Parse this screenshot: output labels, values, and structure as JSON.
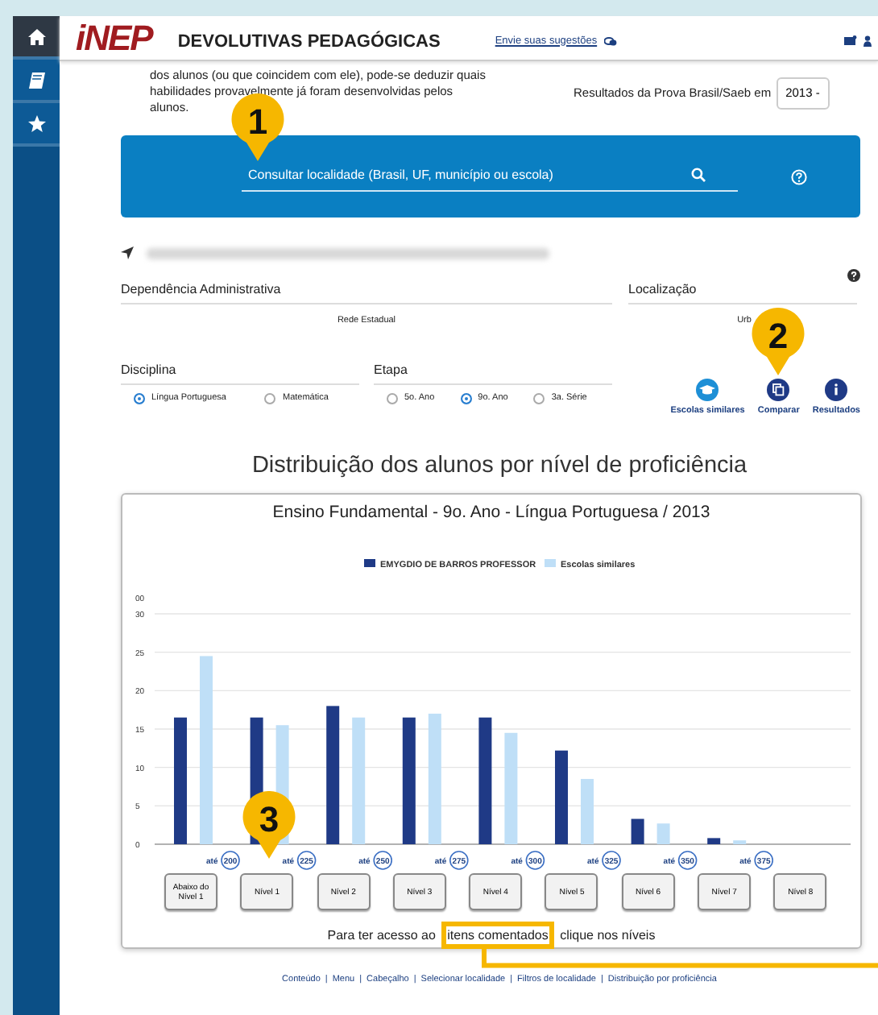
{
  "sidebar": {
    "items": [
      {
        "kind": "home",
        "selected": true
      },
      {
        "kind": "book",
        "selected": false
      },
      {
        "kind": "star",
        "selected": false
      }
    ]
  },
  "header": {
    "logo": "iNEP",
    "title": "DEVOLUTIVAS PEDAGÓGICAS",
    "feedback_link": "Envie suas sugestões"
  },
  "intro": {
    "lines": [
      "dos alunos (ou que coincidem com ele), pode-se deduzir quais",
      "habilidades provavelmente já foram desenvolvidas pelos",
      "alunos."
    ],
    "year_label": "Resultados da Prova Brasil/Saeb em",
    "year": "2013 -"
  },
  "search": {
    "placeholder": "Consultar localidade (Brasil, UF, município ou escola)"
  },
  "school": {
    "dependencia_label": "Dependência Administrativa",
    "dependencia": "Rede Estadual",
    "localizacao_label": "Localização",
    "localizacao": "Urb"
  },
  "disciplina": {
    "label": "Disciplina",
    "options": [
      {
        "label": "Língua Portuguesa",
        "selected": true
      },
      {
        "label": "Matemática",
        "selected": false
      }
    ]
  },
  "etapa": {
    "label": "Etapa",
    "options": [
      {
        "label": "5o. Ano",
        "selected": false
      },
      {
        "label": "9o. Ano",
        "selected": true
      },
      {
        "label": "3a. Série",
        "selected": false
      }
    ]
  },
  "actions": [
    {
      "kind": "similar",
      "label": "Escolas similares"
    },
    {
      "kind": "compare",
      "label": "Comparar"
    },
    {
      "kind": "info",
      "label": "Resultados"
    }
  ],
  "heading": "Distribuição dos alunos por nível de proficiência",
  "chart": {
    "chart_data": {
      "type": "bar",
      "title": "Ensino Fundamental - 9o. Ano - Língua Portuguesa / 2013",
      "grid": true,
      "legend": true,
      "series": [
        {
          "name": "EMYGDIO DE BARROS PROFESSOR",
          "color": "#1f3a86",
          "values": [
            16.5,
            16.5,
            18,
            16.5,
            16.5,
            12.2,
            3.3,
            0.8,
            0
          ]
        },
        {
          "name": "Escolas similares",
          "color": "#bfdff7",
          "values": [
            24.5,
            15.5,
            16.5,
            17,
            14.5,
            8.5,
            2.7,
            0.5,
            0
          ]
        }
      ],
      "ylim": [
        0,
        30
      ],
      "yticks": [
        0,
        5,
        10,
        15,
        20,
        25,
        30
      ],
      "annotations": [
        {
          "text": "00"
        }
      ]
    },
    "thresholds": [
      {
        "prefix": "até",
        "value": "200"
      },
      {
        "prefix": "até",
        "value": "225"
      },
      {
        "prefix": "até",
        "value": "250"
      },
      {
        "prefix": "até",
        "value": "275"
      },
      {
        "prefix": "até",
        "value": "300"
      },
      {
        "prefix": "até",
        "value": "325"
      },
      {
        "prefix": "até",
        "value": "350"
      },
      {
        "prefix": "até",
        "value": "375"
      }
    ],
    "level_buttons": [
      "Abaixo do Nível 1",
      "Nível 1",
      "Nível 2",
      "Nível 3",
      "Nível 4",
      "Nível 5",
      "Nível 6",
      "Nível 7",
      "Nível 8"
    ],
    "caption_before": "Para ter acesso ao",
    "caption_link": "itens comentados",
    "caption_after": "clique nos níveis"
  },
  "footer_links": [
    "Conteúdo",
    "Menu",
    "Cabeçalho",
    "Selecionar localidade",
    "Filtros de localidade",
    "Distribuição por proficiência"
  ],
  "footer_separator": "|",
  "callouts": [
    "1",
    "2",
    "3"
  ]
}
